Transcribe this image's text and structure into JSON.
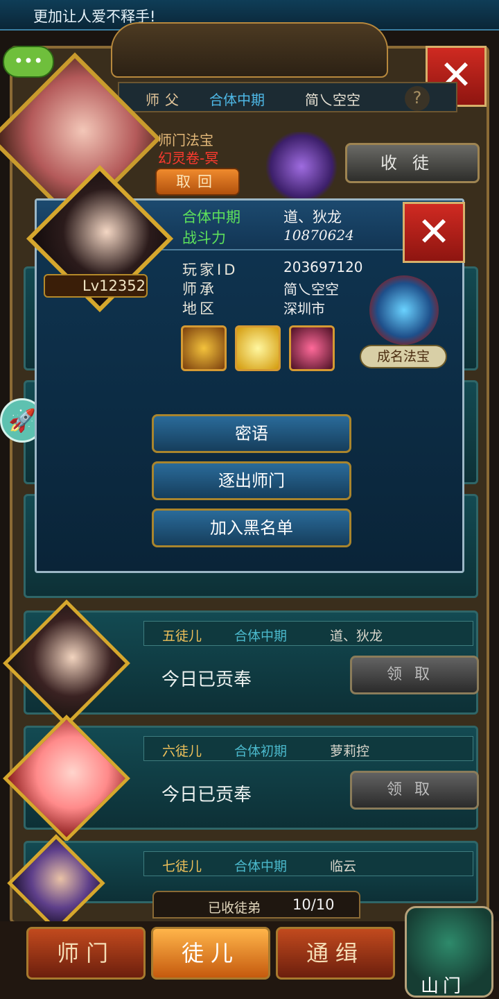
{
  "top_banner": {
    "text": "更加让人爱不释手!"
  },
  "icons": {
    "chat": "chat-bubble-icon",
    "close": "close-icon",
    "help": "help-icon",
    "rocket": "rocket-icon"
  },
  "master": {
    "role": "师父",
    "stage": "合体中期",
    "name": "简乀空空",
    "help": "?",
    "treasure_label": "师门法宝",
    "treasure_name": "幻灵卷-冥",
    "retrieve": "取回",
    "recruit": "收徒"
  },
  "popup": {
    "stage": "合体中期",
    "name": "道、狄龙",
    "power_label": "战斗力",
    "power": "10870624",
    "level": "Lv12352",
    "player_id_label": "玩家ID",
    "player_id": "203697120",
    "lineage_label": "师承",
    "lineage": "简乀空空",
    "region_label": "地区",
    "region": "深圳市",
    "fame_label": "成名法宝",
    "buttons": [
      "密语",
      "逐出师门",
      "加入黑名单"
    ],
    "close": "✕"
  },
  "disciples": [
    {
      "order": "五徒儿",
      "stage": "合体中期",
      "name": "道、狄龙",
      "status": "今日已贡奉",
      "claim": "领取"
    },
    {
      "order": "六徒儿",
      "stage": "合体初期",
      "name": "萝莉控",
      "status": "今日已贡奉",
      "claim": "领取"
    },
    {
      "order": "七徒儿",
      "stage": "合体中期",
      "name": "临云"
    }
  ],
  "footer": {
    "count_label": "已收徒弟",
    "count": "10/10",
    "tabs": [
      "师门",
      "徒儿",
      "通缉"
    ],
    "active_tab": "徒儿",
    "mountain": "山门"
  }
}
